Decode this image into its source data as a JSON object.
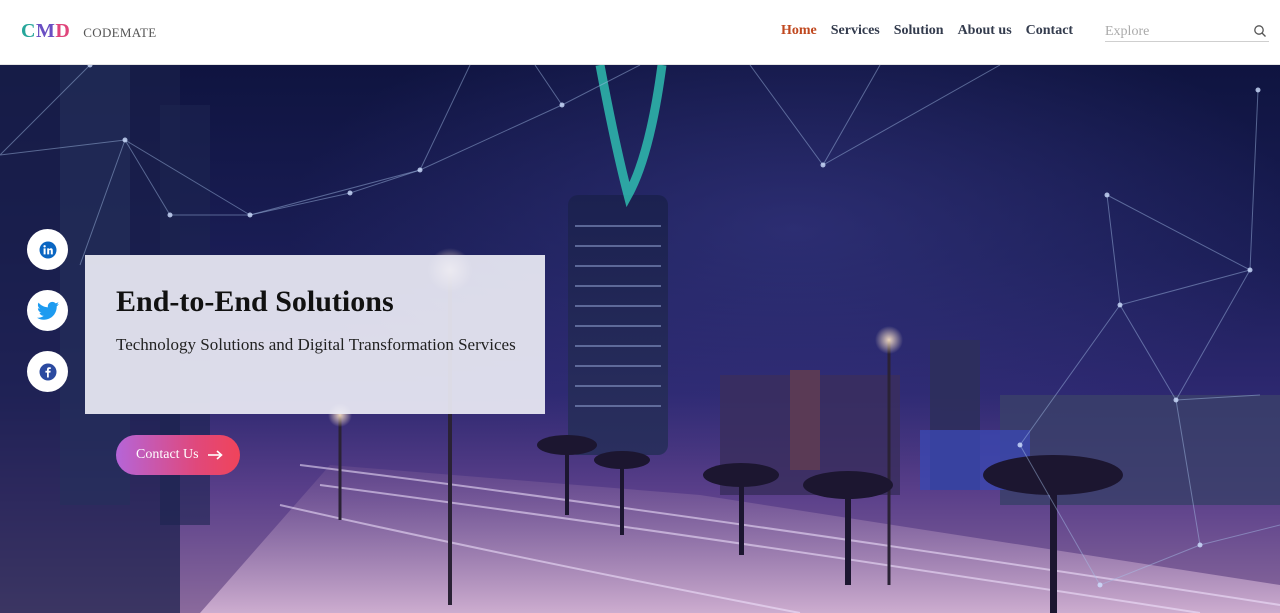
{
  "header": {
    "logo_letters": [
      "C",
      "M",
      "D"
    ],
    "brand_name": "CODEMATE",
    "nav": [
      {
        "label": "Home",
        "active": true
      },
      {
        "label": "Services",
        "active": false
      },
      {
        "label": "Solution",
        "active": false
      },
      {
        "label": "About us",
        "active": false
      },
      {
        "label": "Contact",
        "active": false
      }
    ],
    "search": {
      "placeholder": "Explore",
      "value": "",
      "icon": "search-icon"
    }
  },
  "social": [
    {
      "name": "linkedin",
      "icon": "linkedin-icon"
    },
    {
      "name": "twitter",
      "icon": "twitter-icon"
    },
    {
      "name": "facebook",
      "icon": "facebook-icon"
    }
  ],
  "hero": {
    "title": "End-to-End Solutions",
    "subtitle": "Technology Solutions and Digital Transformation Services",
    "cta_label": "Contact Us",
    "cta_icon": "arrow-right-icon"
  },
  "colors": {
    "nav_active": "#c0481f",
    "nav_text": "#333b4d",
    "logo_c": "#26a69a",
    "logo_m": "#6a4fc3",
    "logo_d": "#e0457b",
    "cta_start": "#b565d8",
    "cta_end": "#f0445a"
  }
}
